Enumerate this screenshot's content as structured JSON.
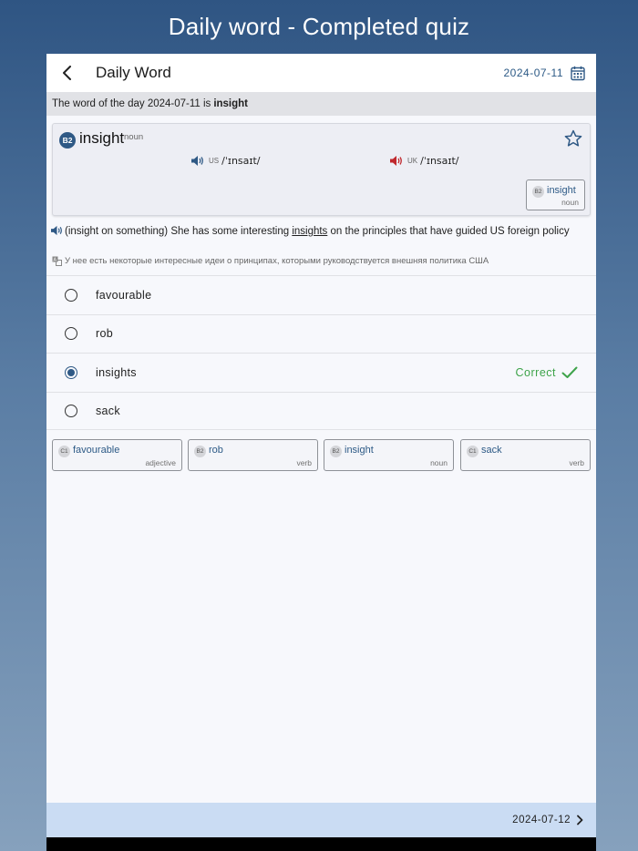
{
  "banner": {
    "title": "Daily word - Completed quiz"
  },
  "appbar": {
    "title": "Daily Word",
    "date": "2024-07-11"
  },
  "subhead": {
    "prefix": "The word of the day 2024-07-11 is",
    "word": "insight"
  },
  "entry": {
    "level": "B2",
    "word": "insight",
    "pos": "noun",
    "us": {
      "region": "US",
      "ipa": "/ˈɪnsaɪt/"
    },
    "uk": {
      "region": "UK",
      "ipa": "/ˈɪnsaɪt/"
    },
    "chip": {
      "level": "B2",
      "word": "insight",
      "pos": "noun"
    }
  },
  "example": {
    "before": "(insight on something) She has some interesting ",
    "highlight": "insights",
    "after": " on the principles that have guided US foreign policy",
    "translation": "У нее есть некоторые интересные идеи о принципах, которыми руководствуется внешняя политика США"
  },
  "options": [
    {
      "label": "favourable"
    },
    {
      "label": "rob"
    },
    {
      "label": "insights",
      "status": "Correct"
    },
    {
      "label": "sack"
    }
  ],
  "word_chips": [
    {
      "level": "C1",
      "word": "favourable",
      "pos": "adjective"
    },
    {
      "level": "B2",
      "word": "rob",
      "pos": "verb"
    },
    {
      "level": "B2",
      "word": "insight",
      "pos": "noun"
    },
    {
      "level": "C1",
      "word": "sack",
      "pos": "verb"
    }
  ],
  "footer": {
    "next_date": "2024-07-12"
  },
  "colors": {
    "accent": "#2f5985",
    "correct": "#3ea34a",
    "uk_speaker": "#c0282d",
    "footer_bg": "#cadcf3"
  },
  "icons": [
    "back-arrow-icon",
    "calendar-icon",
    "star-icon",
    "speaker-icon",
    "translate-icon",
    "checkmark-icon",
    "chevron-right-icon"
  ]
}
